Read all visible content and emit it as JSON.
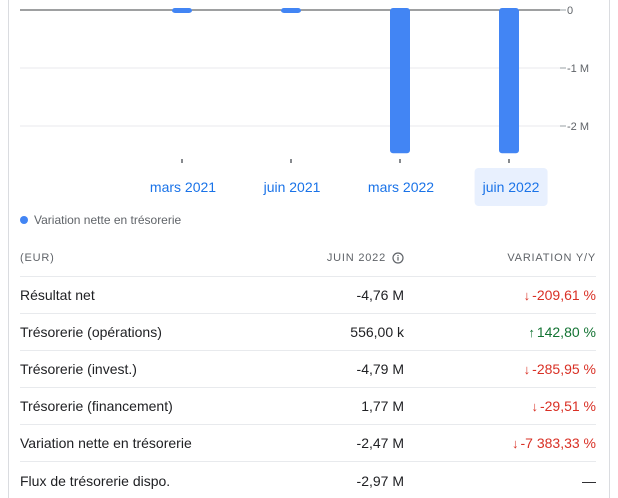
{
  "colors": {
    "bar": "#4285f4",
    "positive": "#137333",
    "negative": "#d93025",
    "link": "#1a73e8",
    "selected_tab_bg": "#e8f0fe"
  },
  "chart_data": {
    "type": "bar",
    "categories": [
      "mars 2021",
      "juin 2021",
      "mars 2022",
      "juin 2022"
    ],
    "series": [
      {
        "name": "Variation nette en trésorerie",
        "values": [
          -0.05,
          -0.05,
          -2.47,
          -2.47
        ]
      }
    ],
    "y_ticks": [
      {
        "value": 0,
        "label": "0"
      },
      {
        "value": -1,
        "label": "-1 M"
      },
      {
        "value": -2,
        "label": "-2 M"
      }
    ],
    "ylim": [
      -2.5,
      0
    ],
    "grid": true,
    "legend": "bottom-left"
  },
  "tabs": [
    {
      "label": "mars 2021",
      "selected": false
    },
    {
      "label": "juin 2021",
      "selected": false
    },
    {
      "label": "mars 2022",
      "selected": false
    },
    {
      "label": "juin 2022",
      "selected": true
    }
  ],
  "legend": {
    "label": "Variation nette en trésorerie"
  },
  "table": {
    "headers": {
      "name": "(EUR)",
      "value": "JUIN 2022",
      "change": "VARIATION Y/Y"
    },
    "rows": [
      {
        "name": "Résultat net",
        "value": "-4,76 M",
        "change": "-209,61 %",
        "trend": "down"
      },
      {
        "name": "Trésorerie (opérations)",
        "value": "556,00 k",
        "change": "142,80 %",
        "trend": "up"
      },
      {
        "name": "Trésorerie (invest.)",
        "value": "-4,79 M",
        "change": "-285,95 %",
        "trend": "down"
      },
      {
        "name": "Trésorerie (financement)",
        "value": "1,77 M",
        "change": "-29,51 %",
        "trend": "down"
      },
      {
        "name": "Variation nette en trésorerie",
        "value": "-2,47 M",
        "change": "-7 383,33 %",
        "trend": "down"
      },
      {
        "name": "Flux de trésorerie dispo.",
        "value": "-2,97 M",
        "change": "—",
        "trend": "none"
      }
    ]
  }
}
